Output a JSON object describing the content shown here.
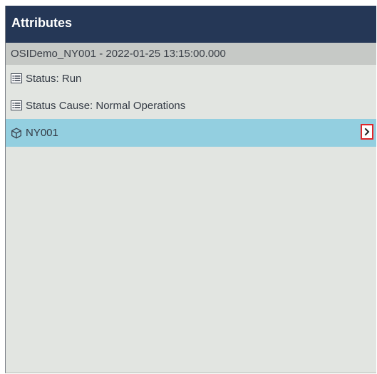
{
  "header": {
    "title": "Attributes"
  },
  "context": {
    "label": "OSIDemo_NY001 - 2022-01-25 13:15:00.000"
  },
  "items": [
    {
      "label": "Status: Run",
      "icon": "attribute-list-icon"
    },
    {
      "label": "Status Cause: Normal Operations",
      "icon": "attribute-list-icon"
    },
    {
      "label": "NY001",
      "icon": "element-cube-icon",
      "selected": true,
      "action_icon": "chevron-right-icon"
    }
  ],
  "colors": {
    "header_bg": "#253756",
    "subheader_bg": "#c6c9c6",
    "panel_bg": "#e2e5e1",
    "selected_bg": "#93cfe0",
    "highlight_border": "#e0262a"
  }
}
